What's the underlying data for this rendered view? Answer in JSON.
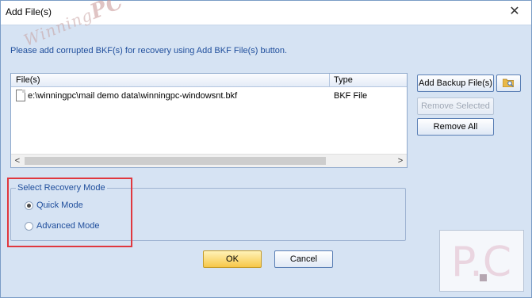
{
  "window": {
    "title": "Add File(s)",
    "close_glyph": "✕"
  },
  "watermark": {
    "top_left_text": "Winning",
    "top_left_pc": "PC",
    "bottom_right_text": "P.C"
  },
  "instructions": "Please add corrupted BKF(s) for recovery using Add BKF File(s) button.",
  "file_list": {
    "columns": [
      "File(s)",
      "Type"
    ],
    "rows": [
      {
        "path": "e:\\winningpc\\mail demo data\\winningpc-windowsnt.bkf",
        "type": "BKF File"
      }
    ],
    "scroll_left_glyph": "<",
    "scroll_right_glyph": ">"
  },
  "buttons": {
    "add_backup": "Add Backup File(s)",
    "remove_selected": "Remove Selected",
    "remove_all": "Remove All",
    "ok": "OK",
    "cancel": "Cancel"
  },
  "recovery_mode": {
    "title": "Select Recovery Mode",
    "options": [
      {
        "label": "Quick Mode",
        "selected": true
      },
      {
        "label": "Advanced Mode",
        "selected": false
      }
    ]
  },
  "colors": {
    "accent": "#1f4e9c",
    "highlight": "#e0383f",
    "ok_button": "#f7c748",
    "background": "#d6e3f3"
  }
}
